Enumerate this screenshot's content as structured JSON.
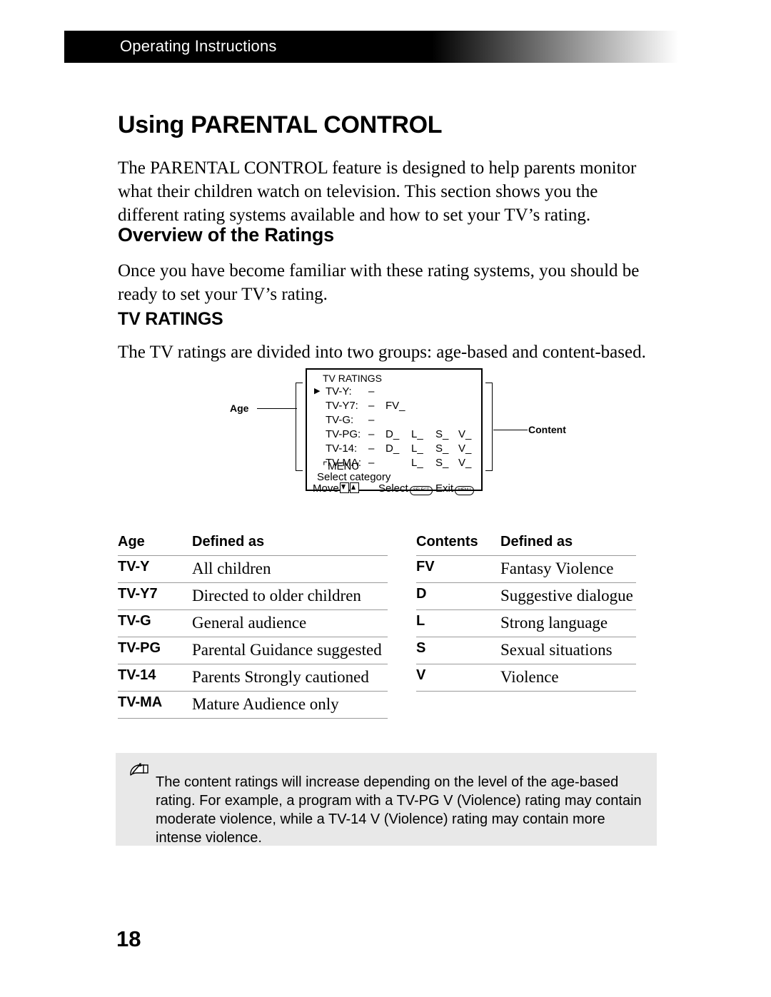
{
  "header": {
    "running_head": "Operating Instructions"
  },
  "page": {
    "title": "Using PARENTAL CONTROL",
    "intro": "The PARENTAL CONTROL feature is designed to help parents monitor what their children watch on television. This section shows you the different rating systems available and how to set your TV’s rating.",
    "number": "18"
  },
  "sections": {
    "overview_heading": "Overview of the Ratings",
    "overview_para": "Once you have become familiar with these rating systems, you should be ready to set your TV’s rating.",
    "tvratings_heading": "TV RATINGS",
    "tvratings_para": "The TV ratings are divided into two groups: age-based and content-based."
  },
  "diagram": {
    "age_label": "Age",
    "content_label": "Content",
    "osd_title": "TV RATINGS",
    "cursor_glyph": "▶",
    "rows": [
      {
        "label": "TV-Y:",
        "dash": "–",
        "fv": "",
        "d": "",
        "l": "",
        "s": "",
        "v": "",
        "selected": true
      },
      {
        "label": "TV-Y7:",
        "dash": "–",
        "fv": "FV_",
        "d": "",
        "l": "",
        "s": "",
        "v": "",
        "selected": false
      },
      {
        "label": "TV-G:",
        "dash": "–",
        "fv": "",
        "d": "",
        "l": "",
        "s": "",
        "v": "",
        "selected": false
      },
      {
        "label": "TV-PG:",
        "dash": "–",
        "fv": "",
        "d": "D_",
        "l": "L_",
        "s": "S_",
        "v": "V_",
        "selected": false
      },
      {
        "label": "TV-14:",
        "dash": "–",
        "fv": "",
        "d": "D_",
        "l": "L_",
        "s": "S_",
        "v": "V_",
        "selected": false
      },
      {
        "label": "TV-MA:",
        "dash": "–",
        "fv": "",
        "d": "",
        "l": "L_",
        "s": "S_",
        "v": "V_",
        "selected": false
      }
    ],
    "menu_return": "MENU",
    "select_category": "Select category",
    "move_label": "Move",
    "select_label": "Select",
    "select_button": "SELECT",
    "exit_label": "Exit",
    "exit_button": "MENU"
  },
  "age_table": {
    "col1": "Age",
    "col2": "Defined as",
    "rows": [
      {
        "key": "TV-Y",
        "value": "All children"
      },
      {
        "key": "TV-Y7",
        "value": "Directed to older children"
      },
      {
        "key": "TV-G",
        "value": "General audience"
      },
      {
        "key": "TV-PG",
        "value": "Parental Guidance suggested"
      },
      {
        "key": "TV-14",
        "value": "Parents Strongly cautioned"
      },
      {
        "key": "TV-MA",
        "value": "Mature Audience only"
      }
    ]
  },
  "contents_table": {
    "col1": "Contents",
    "col2": "Defined as",
    "rows": [
      {
        "key": "FV",
        "value": "Fantasy Violence"
      },
      {
        "key": "D",
        "value": "Suggestive dialogue"
      },
      {
        "key": "L",
        "value": "Strong language"
      },
      {
        "key": "S",
        "value": "Sexual situations"
      },
      {
        "key": "V",
        "value": "Violence"
      }
    ]
  },
  "note": {
    "icon": "note-pen-icon",
    "text": "The content ratings will increase depending on the level of the age-based rating. For example, a program with a TV-PG V (Violence) rating may contain moderate violence, while a TV-14 V (Violence) rating may contain more intense violence."
  },
  "colors": {
    "note_background": "#e8e8e8",
    "rule": "#9a9a9a",
    "header_band": "#000000"
  }
}
